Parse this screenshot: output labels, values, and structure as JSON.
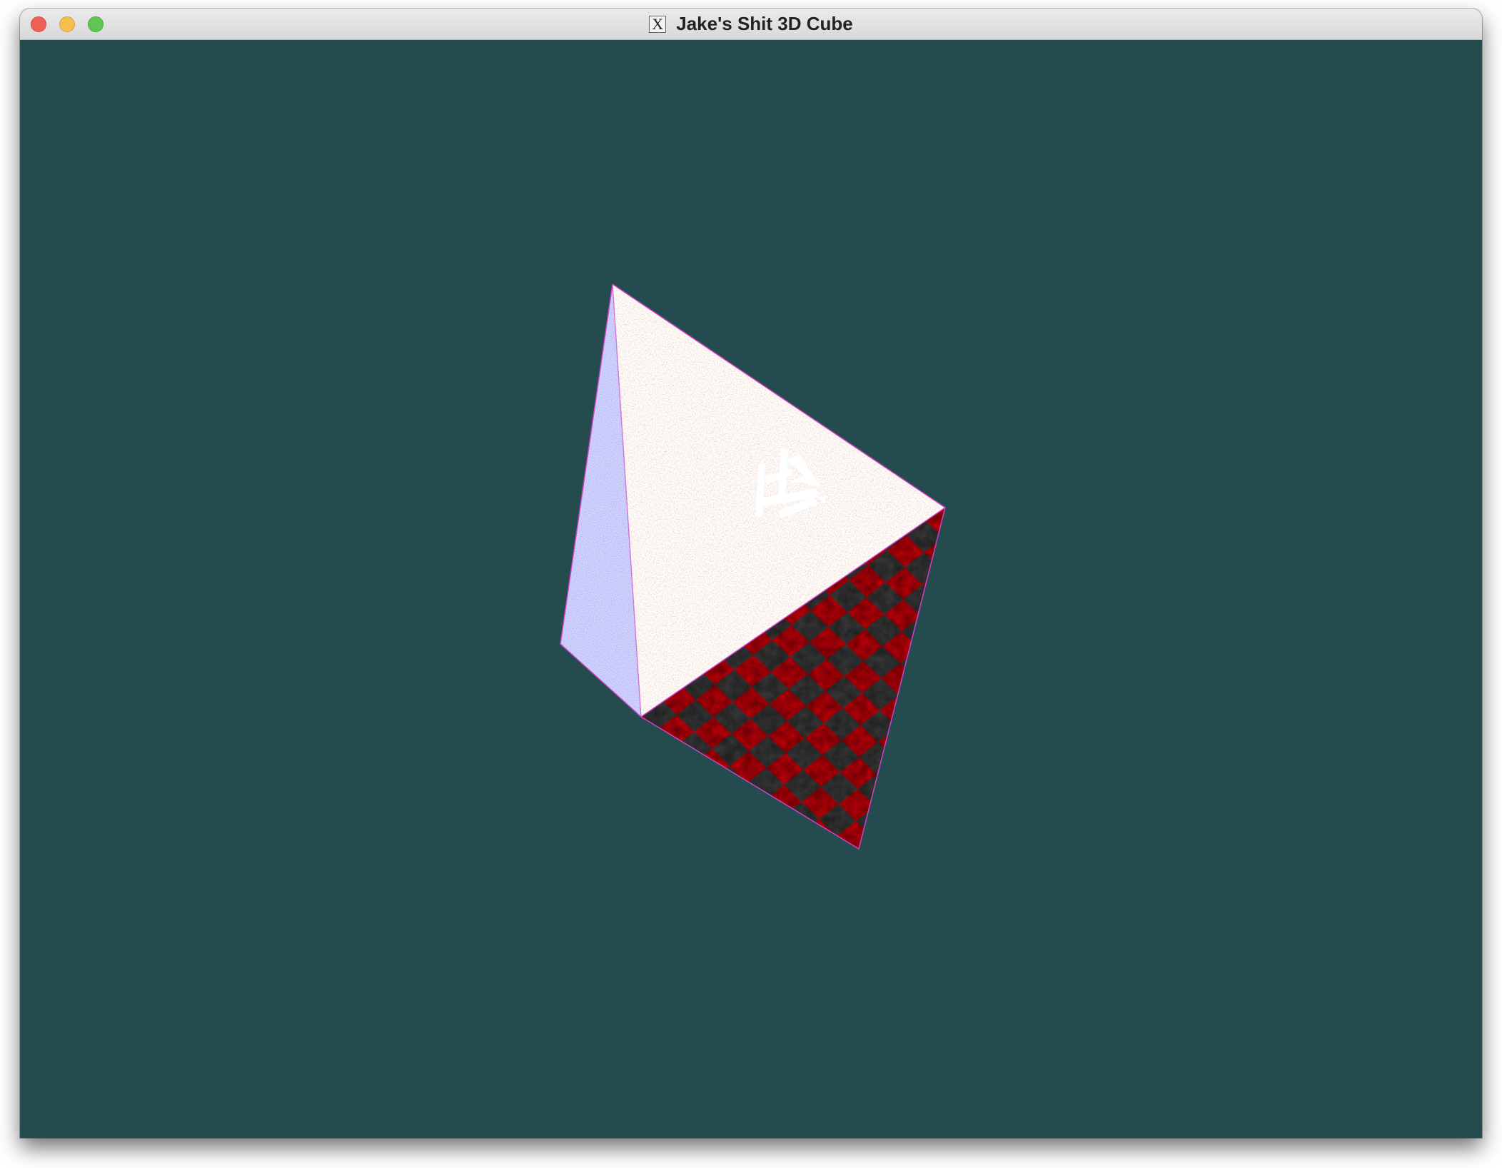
{
  "window": {
    "title": "Jake's Shit 3D Cube",
    "app_icon": "x11-icon",
    "app_icon_glyph": "X",
    "controls": [
      "close",
      "minimize",
      "maximize"
    ]
  },
  "scene": {
    "background_color": "#244c4e",
    "object": "pyramid",
    "faces": [
      {
        "name": "gravel-face",
        "texture": "gravel",
        "color": "#a79a92"
      },
      {
        "name": "blue-noise-face",
        "texture": "blue-noise",
        "color": "#4a4c86"
      },
      {
        "name": "checker-face",
        "texture": "red-black-checkerboard",
        "colors": [
          "#b00008",
          "#333333"
        ]
      }
    ],
    "edge_color": "#d040c8"
  }
}
